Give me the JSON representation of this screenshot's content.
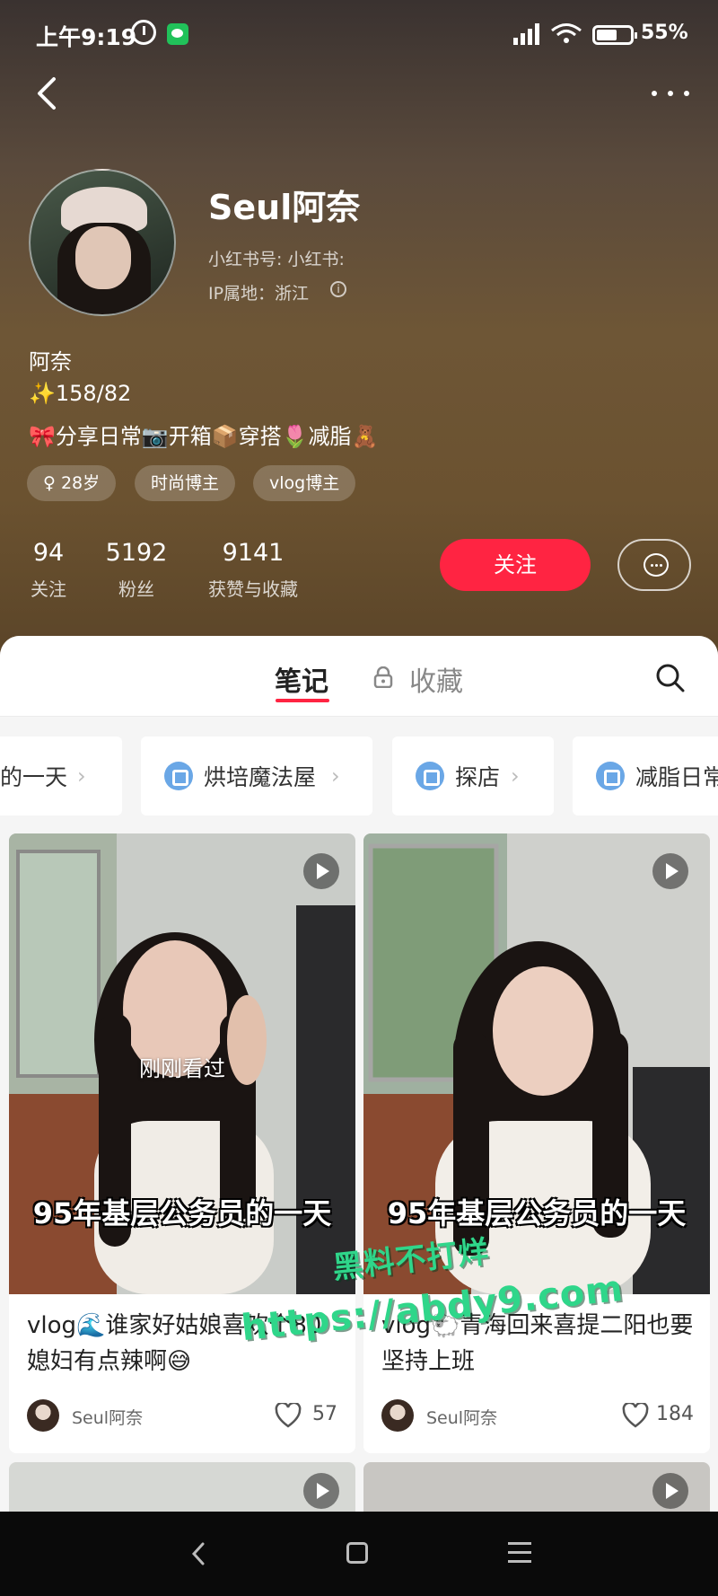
{
  "status_bar": {
    "time": "上午9:19",
    "battery": "55%"
  },
  "profile": {
    "name": "Seul阿奈",
    "red_id": "小红书号: 小红书:",
    "ip_location": "IP属地：浙江",
    "bio": [
      "阿奈",
      "✨158/82",
      "🎀分享日常📷开箱📦穿搭🌷减脂🧸"
    ],
    "tags": [
      "♀ 28岁",
      "时尚博主",
      "vlog博主"
    ],
    "stats": [
      {
        "value": "94",
        "label": "关注"
      },
      {
        "value": "5192",
        "label": "粉丝"
      },
      {
        "value": "9141",
        "label": "获赞与收藏"
      }
    ],
    "follow_label": "关注"
  },
  "tabs": {
    "notes": "笔记",
    "collect": "收藏"
  },
  "collections": [
    "的一天",
    "烘培魔法屋",
    "探店",
    "减脂日常"
  ],
  "notes": [
    {
      "seen_label": "刚刚看过",
      "caption": "95年基层公务员的一天",
      "title": "vlog🌊谁家好姑娘喜欢个80媳妇有点辣啊😅",
      "author": "Seul阿奈",
      "likes": "57"
    },
    {
      "seen_label": "",
      "caption": "95年基层公务员的一天",
      "title": "vlog🐑青海回来喜提二阳也要坚持上班",
      "author": "Seul阿奈",
      "likes": "184"
    }
  ],
  "watermark": {
    "line1": "黑料不打烊",
    "line2": "https://abdy9.com"
  },
  "colors": {
    "accent": "#ff2442",
    "watermark": "#2fd68a",
    "collection_icon": "#6aa7e6"
  }
}
